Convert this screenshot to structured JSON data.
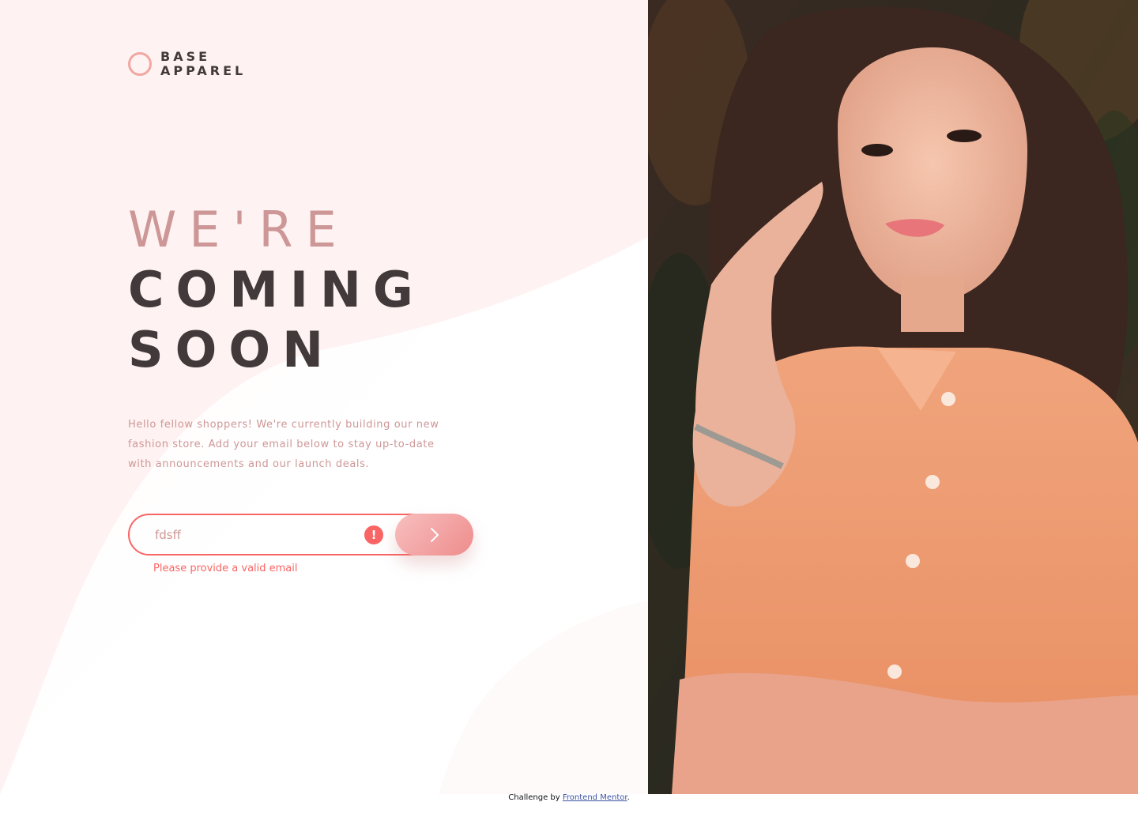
{
  "brand": {
    "line1": "BASE",
    "line2": "APPAREL"
  },
  "headline": {
    "light": "WE'RE",
    "line2": "COMING",
    "line3": "SOON"
  },
  "description": "Hello fellow shoppers! We're currently building our new fashion store. Add your email below to stay up-to-date with announcements and our launch deals.",
  "form": {
    "email_value": "fdsff",
    "error_message": "Please provide a valid email"
  },
  "icons": {
    "logo": "ring-logo-icon",
    "error": "exclamation-circle-icon",
    "submit": "chevron-right-icon"
  },
  "footer": {
    "prefix": "Challenge by",
    "link_text": "Frontend Mentor",
    "suffix": "."
  },
  "colors": {
    "accent": "#f96464",
    "text_pink": "#ce9797",
    "text_dark": "#423a3a",
    "button_gradient_start": "#f8bfbf",
    "button_gradient_end": "#ee8c8c",
    "link": "#3d52a0"
  }
}
